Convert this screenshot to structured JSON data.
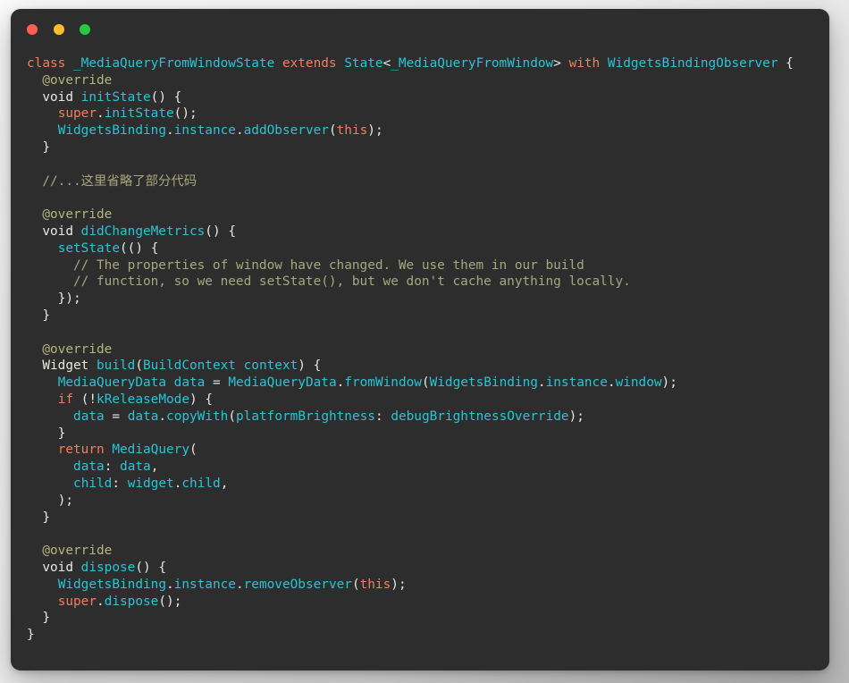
{
  "window": {
    "title_bar": {
      "buttons": [
        {
          "name": "close",
          "label": "",
          "color": "#ff5f56"
        },
        {
          "name": "minimize",
          "label": "",
          "color": "#ffbd2e"
        },
        {
          "name": "maximize",
          "label": "",
          "color": "#27c93f"
        }
      ]
    },
    "background": "#2d2d2d",
    "page_background_from": "#fbfbfb",
    "page_background_to": "#b9b9b9"
  },
  "theme": {
    "keyword": "#f07e62",
    "type": "#29c5d6",
    "plain": "#e8e8e3",
    "annotation": "#b4b77a",
    "comment": "#a6a87d"
  },
  "code": {
    "language": "dart",
    "lines": [
      "class _MediaQueryFromWindowState extends State<_MediaQueryFromWindow> with WidgetsBindingObserver {",
      "  @override",
      "  void initState() {",
      "    super.initState();",
      "    WidgetsBinding.instance.addObserver(this);",
      "  }",
      "",
      "  //...这里省略了部分代码",
      "",
      "  @override",
      "  void didChangeMetrics() {",
      "    setState(() {",
      "      // The properties of window have changed. We use them in our build",
      "      // function, so we need setState(), but we don't cache anything locally.",
      "    });",
      "  }",
      "",
      "  @override",
      "  Widget build(BuildContext context) {",
      "    MediaQueryData data = MediaQueryData.fromWindow(WidgetsBinding.instance.window);",
      "    if (!kReleaseMode) {",
      "      data = data.copyWith(platformBrightness: debugBrightnessOverride);",
      "    }",
      "    return MediaQuery(",
      "      data: data,",
      "      child: widget.child,",
      "    );",
      "  }",
      "",
      "  @override",
      "  void dispose() {",
      "    WidgetsBinding.instance.removeObserver(this);",
      "    super.dispose();",
      "  }",
      "}"
    ]
  }
}
